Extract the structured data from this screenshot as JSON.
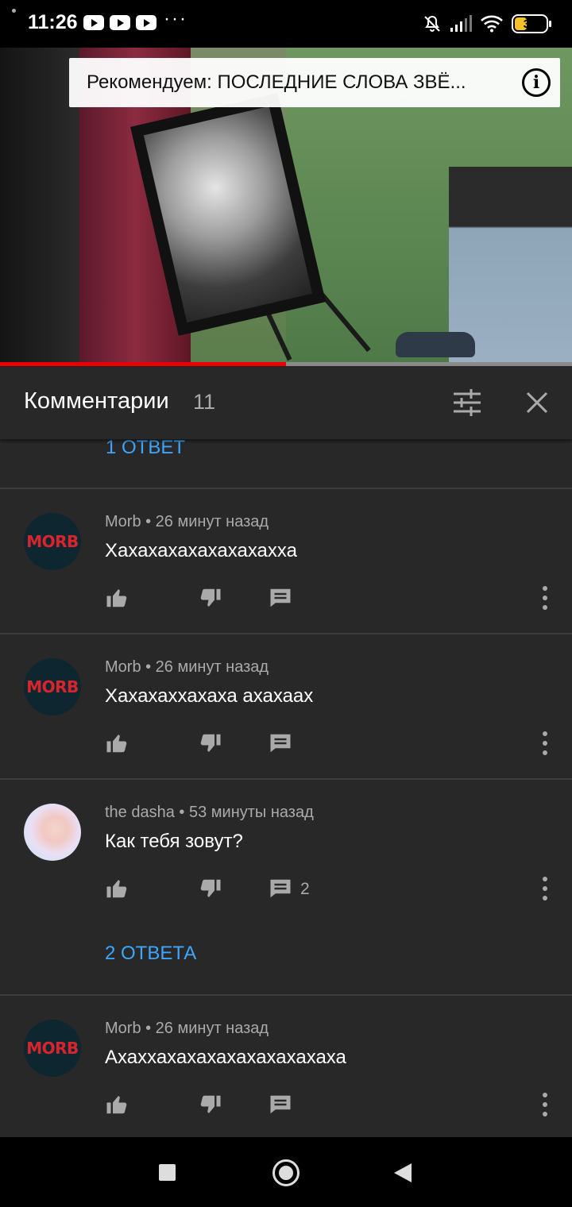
{
  "status_bar": {
    "time": "11:26",
    "more": "···",
    "battery": "35"
  },
  "video": {
    "recommendation": "Рекомендуем: ПОСЛЕДНИЕ СЛОВА ЗВЁ...",
    "progress": 0.5
  },
  "comments_header": {
    "title": "Комментарии",
    "count": "11"
  },
  "top_reply_link": "1 ОТВЕТ",
  "comments": [
    {
      "avatar": "MORB",
      "meta": "Morb • 26 минут назад",
      "text": "Хахахахахахахахахха",
      "reply_count": ""
    },
    {
      "avatar": "MORB",
      "meta": "Morb • 26 минут назад",
      "text": "Хахахаххахаха ахахаах",
      "reply_count": ""
    },
    {
      "avatar": "",
      "meta": "the dasha • 53 минуты назад",
      "text": "Как тебя зовут?",
      "reply_count": "2",
      "replies_link": "2 ОТВЕТА"
    },
    {
      "avatar": "MORB",
      "meta": "Morb • 26 минут назад",
      "text": "Ахаххахахахахахахахахаха",
      "reply_count": ""
    }
  ],
  "colors": {
    "accent_link": "#3ea6ff",
    "progress": "#ee0000",
    "background": "#282828"
  }
}
